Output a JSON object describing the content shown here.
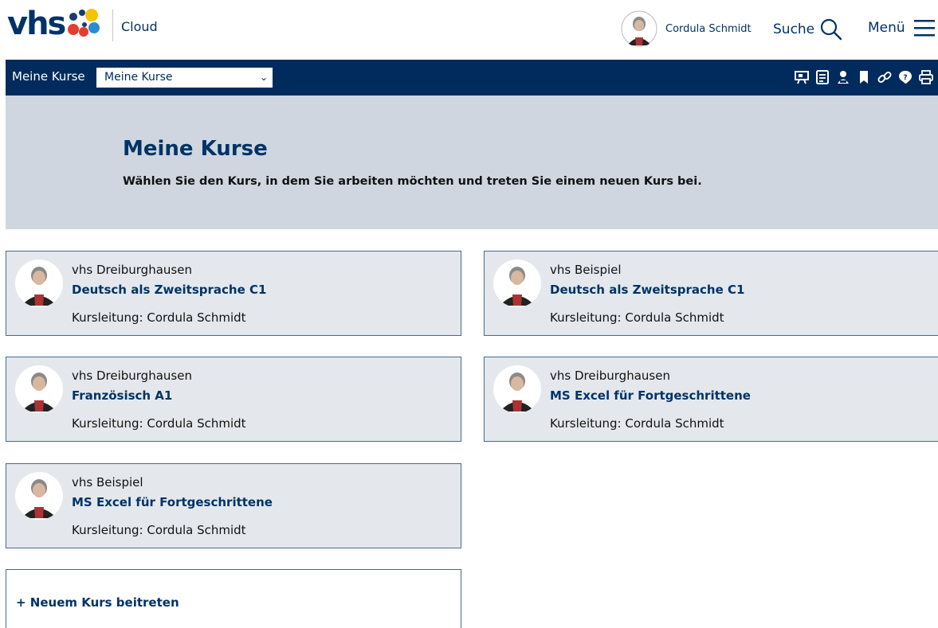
{
  "header": {
    "logo_text": "vhs",
    "product": "Cloud",
    "user_name": "Cordula Schmidt",
    "search_label": "Suche",
    "menu_label": "Menü"
  },
  "navbar": {
    "label": "Meine Kurse",
    "select_value": "Meine Kurse",
    "tools": [
      "presentation-icon",
      "notes-icon",
      "user-icon",
      "bookmark-icon",
      "link-icon",
      "help-icon",
      "print-icon"
    ]
  },
  "hero": {
    "title": "Meine Kurse",
    "subtitle": "Wählen Sie den Kurs, in dem Sie arbeiten möchten und treten Sie einem neuen Kurs bei."
  },
  "courses": [
    {
      "org": "vhs Dreiburghausen",
      "title": "Deutsch als Zweitsprache C1",
      "lead": "Kursleitung: Cordula Schmidt"
    },
    {
      "org": "vhs Beispiel",
      "title": "Deutsch als Zweitsprache C1",
      "lead": "Kursleitung: Cordula Schmidt"
    },
    {
      "org": "vhs Dreiburghausen",
      "title": "Französisch A1",
      "lead": "Kursleitung: Cordula Schmidt"
    },
    {
      "org": "vhs Dreiburghausen",
      "title": "MS Excel für Fortgeschrittene",
      "lead": "Kursleitung: Cordula Schmidt"
    },
    {
      "org": "vhs Beispiel",
      "title": "MS Excel für Fortgeschrittene",
      "lead": "Kursleitung: Cordula Schmidt"
    }
  ],
  "join": {
    "label": "+ Neuem Kurs beitreten"
  },
  "colors": {
    "brand": "#003366",
    "navbar": "#002b5c",
    "hero_bg": "#cfd6df",
    "card_bg": "#e4e8ed"
  }
}
